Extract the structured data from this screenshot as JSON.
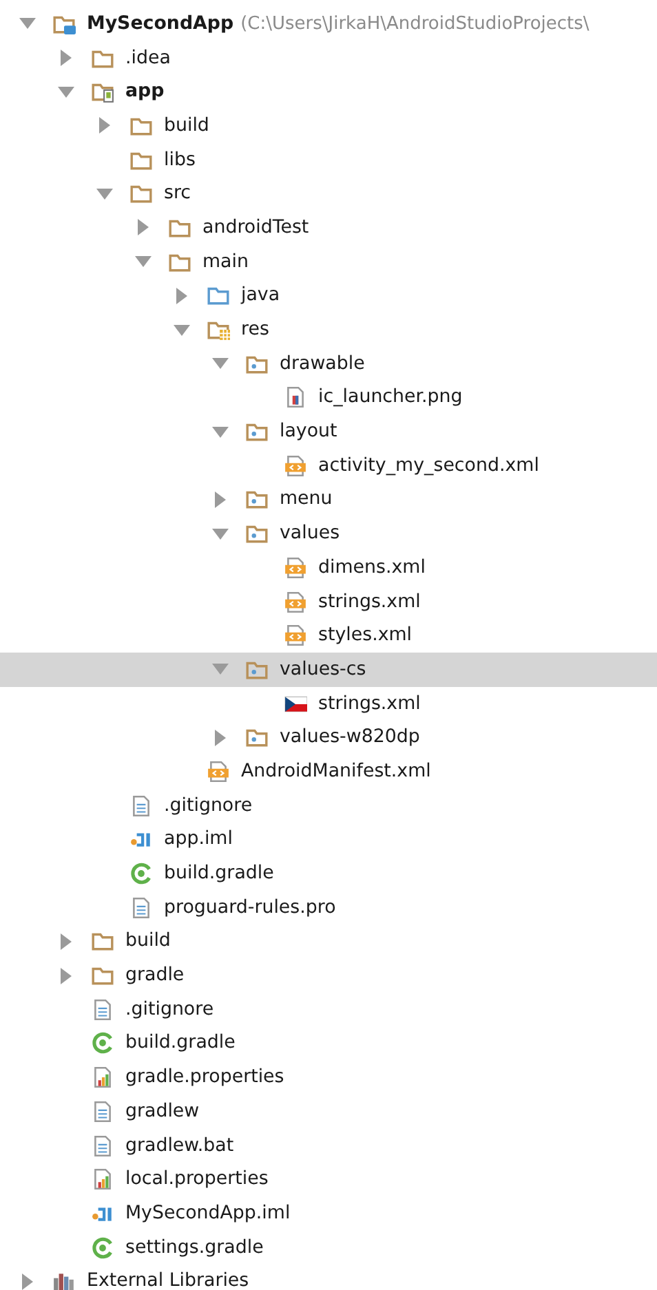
{
  "tree": [
    {
      "label": "MySecondApp",
      "path": "(C:\\Users\\JirkaH\\AndroidStudioProjects\\",
      "kind": "project",
      "expanded": true,
      "selected": false,
      "children": [
        {
          "label": ".idea",
          "kind": "folder",
          "expanded": false,
          "selected": false
        },
        {
          "label": "app",
          "kind": "module",
          "expanded": true,
          "selected": false,
          "children": [
            {
              "label": "build",
              "kind": "folder",
              "expanded": false,
              "selected": false
            },
            {
              "label": "libs",
              "kind": "folder",
              "selected": false
            },
            {
              "label": "src",
              "kind": "folder",
              "expanded": true,
              "selected": false,
              "children": [
                {
                  "label": "androidTest",
                  "kind": "folder",
                  "expanded": false,
                  "selected": false
                },
                {
                  "label": "main",
                  "kind": "folder",
                  "expanded": true,
                  "selected": false,
                  "children": [
                    {
                      "label": "java",
                      "kind": "source",
                      "expanded": false,
                      "selected": false
                    },
                    {
                      "label": "res",
                      "kind": "res",
                      "expanded": true,
                      "selected": false,
                      "children": [
                        {
                          "label": "drawable",
                          "kind": "resdir",
                          "expanded": true,
                          "selected": false,
                          "children": [
                            {
                              "label": "ic_launcher.png",
                              "kind": "image",
                              "selected": false
                            }
                          ]
                        },
                        {
                          "label": "layout",
                          "kind": "resdir",
                          "expanded": true,
                          "selected": false,
                          "children": [
                            {
                              "label": "activity_my_second.xml",
                              "kind": "xml",
                              "selected": false
                            }
                          ]
                        },
                        {
                          "label": "menu",
                          "kind": "resdir",
                          "expanded": false,
                          "selected": false
                        },
                        {
                          "label": "values",
                          "kind": "resdir",
                          "expanded": true,
                          "selected": false,
                          "children": [
                            {
                              "label": "dimens.xml",
                              "kind": "xml",
                              "selected": false
                            },
                            {
                              "label": "strings.xml",
                              "kind": "xml",
                              "selected": false
                            },
                            {
                              "label": "styles.xml",
                              "kind": "xml",
                              "selected": false
                            }
                          ]
                        },
                        {
                          "label": "values-cs",
                          "kind": "resdir",
                          "expanded": true,
                          "selected": true,
                          "children": [
                            {
                              "label": "strings.xml",
                              "kind": "flag",
                              "selected": false
                            }
                          ]
                        },
                        {
                          "label": "values-w820dp",
                          "kind": "resdir",
                          "expanded": false,
                          "selected": false
                        }
                      ]
                    },
                    {
                      "label": "AndroidManifest.xml",
                      "kind": "xml",
                      "selected": false
                    }
                  ]
                }
              ]
            },
            {
              "label": ".gitignore",
              "kind": "text",
              "selected": false
            },
            {
              "label": "app.iml",
              "kind": "iml",
              "selected": false
            },
            {
              "label": "build.gradle",
              "kind": "gradle",
              "selected": false
            },
            {
              "label": "proguard-rules.pro",
              "kind": "text",
              "selected": false
            }
          ]
        },
        {
          "label": "build",
          "kind": "folder",
          "expanded": false,
          "selected": false
        },
        {
          "label": "gradle",
          "kind": "folder",
          "expanded": false,
          "selected": false
        },
        {
          "label": ".gitignore",
          "kind": "text",
          "selected": false
        },
        {
          "label": "build.gradle",
          "kind": "gradle",
          "selected": false
        },
        {
          "label": "gradle.properties",
          "kind": "properties",
          "selected": false
        },
        {
          "label": "gradlew",
          "kind": "text",
          "selected": false
        },
        {
          "label": "gradlew.bat",
          "kind": "text",
          "selected": false
        },
        {
          "label": "local.properties",
          "kind": "properties",
          "selected": false
        },
        {
          "label": "MySecondApp.iml",
          "kind": "iml",
          "selected": false
        },
        {
          "label": "settings.gradle",
          "kind": "gradle",
          "selected": false
        }
      ]
    },
    {
      "label": "External Libraries",
      "kind": "libraries",
      "expanded": false,
      "selected": false
    }
  ]
}
